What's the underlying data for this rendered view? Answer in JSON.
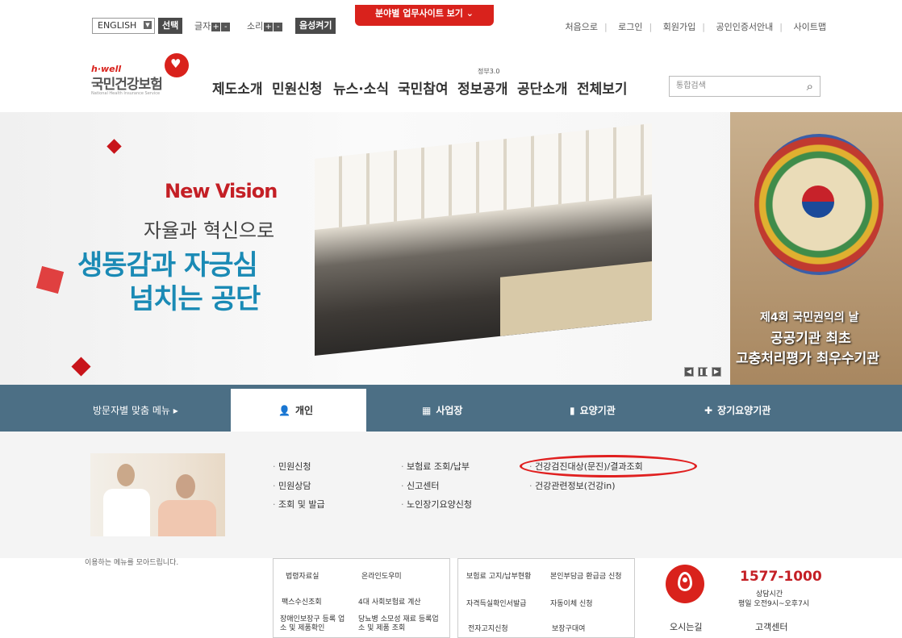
{
  "top_util": {
    "lang_value": "ENGLISH",
    "lang_select_button": "선택",
    "font_label": "글자",
    "sound_label": "소리",
    "voice_button": "음성켜기",
    "plus": "+",
    "minus": "-"
  },
  "field_tab": {
    "label": "분야별 업무사이트 보기",
    "chevron": "⌄"
  },
  "top_links": [
    "처음으로",
    "로그인",
    "회원가입",
    "공인인증서안내",
    "사이트맵"
  ],
  "logo": {
    "small": "h·well",
    "main": "국민건강보험",
    "eng": "National Health Insurance Service"
  },
  "nav": {
    "items": [
      "제도소개",
      "민원신청",
      "뉴스·소식",
      "국민참여",
      "정보공개",
      "공단소개",
      "전체보기"
    ],
    "superscript": "정부3.0"
  },
  "search": {
    "placeholder": "통합검색",
    "icon": "search-icon"
  },
  "banner": {
    "new_vision": "New Vision",
    "line1": "자율과 혁신으로",
    "line2": "생동감과 자긍심",
    "line3": "넘치는 공단",
    "right_line1": "제4회 국민권익의 날",
    "right_line2": "공공기관 최초",
    "right_line3": "고충처리평가 최우수기관",
    "controls": [
      "◀",
      "❚❚",
      "▶"
    ]
  },
  "menu_bar": {
    "visitor_label": "방문자별 맞춤 메뉴 ▸",
    "tabs": [
      "개인",
      "사업장",
      "요양기관",
      "장기요양기관"
    ]
  },
  "submenu": {
    "col1": [
      "민원신청",
      "민원상담",
      "조회 및 발급"
    ],
    "col2": [
      "보험료 조회/납부",
      "신고센터",
      "노인장기요양신청"
    ],
    "col3": [
      "건강검진대상(문진)/결과조회",
      "건강관련정보(건강in)"
    ]
  },
  "footer": {
    "cut_text": "이용하는 메뉴를 모아드립니다.",
    "grid1": [
      "법령자료실",
      "온라인도우미",
      "팩스수신조회",
      "4대 사회보험료 계산",
      "장애인보장구 등록 업소 및 제품확인",
      "당뇨병 소모성 재료 등록업소 및 제품 조회"
    ],
    "grid2": [
      "보험료 고지/납부현황",
      "본인부담금 환급금 신청",
      "자격득실확인서발급",
      "자동이체 신청",
      "전자고지신청",
      "보장구대여"
    ],
    "directions": "오시는길",
    "phone": "1577-1000",
    "hours_title": "상담시간",
    "hours": "평일 오전9시~오후7시",
    "center": "고객센터"
  },
  "colors": {
    "brand_red": "#d9221c",
    "menu_blue": "#4c6f85",
    "banner_blue": "#1a8ab5"
  }
}
